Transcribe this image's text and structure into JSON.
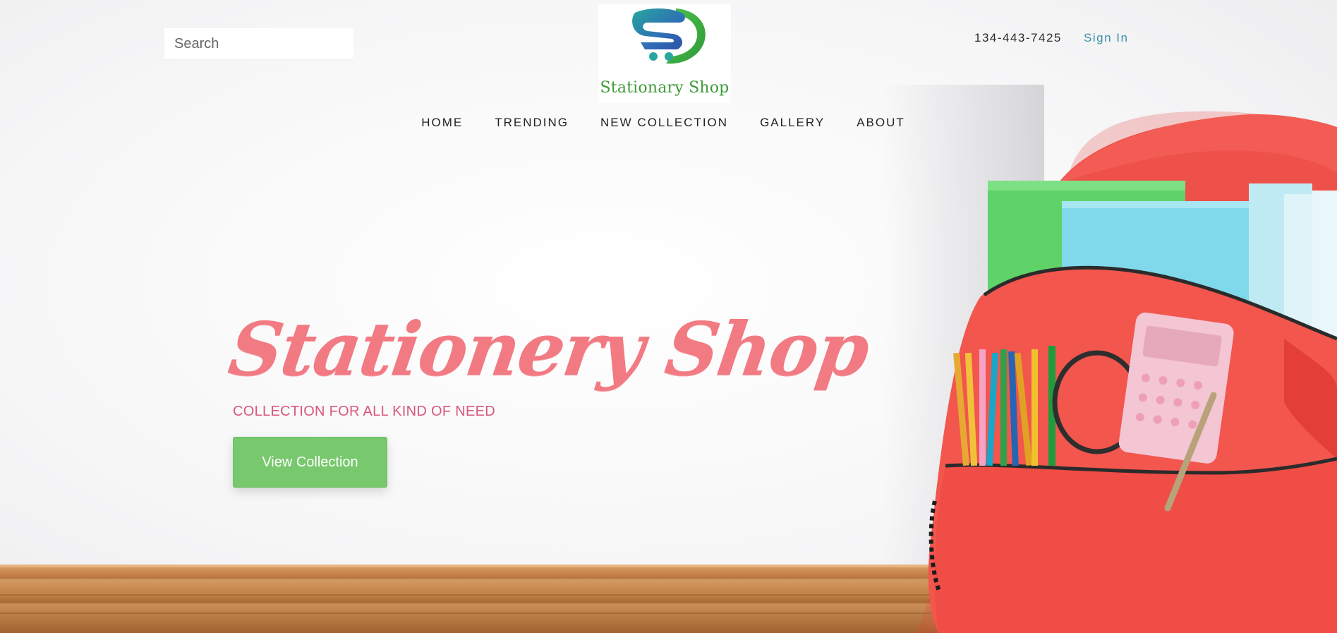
{
  "header": {
    "search": {
      "placeholder": "Search"
    },
    "logo": {
      "text": "Stationary Shop"
    },
    "phone": "134-443-7425",
    "signin_label": "Sign In"
  },
  "nav": {
    "items": [
      {
        "label": "HOME"
      },
      {
        "label": "TRENDING"
      },
      {
        "label": "NEW COLLECTION"
      },
      {
        "label": "GALLERY"
      },
      {
        "label": "ABOUT"
      }
    ]
  },
  "hero": {
    "title": "Stationery Shop",
    "subtitle": "COLLECTION FOR ALL KIND OF NEED",
    "cta_label": "View Collection"
  },
  "colors": {
    "accent_green": "#78c86e",
    "title_pink": "#f27a83",
    "subtitle_pink": "#d9577a",
    "link_teal": "#3e8fa8",
    "logo_green": "#3f9b3a",
    "backpack_red": "#f05a52"
  },
  "icons": {
    "logo_mark": "shopping-cart-s-logo-icon"
  }
}
